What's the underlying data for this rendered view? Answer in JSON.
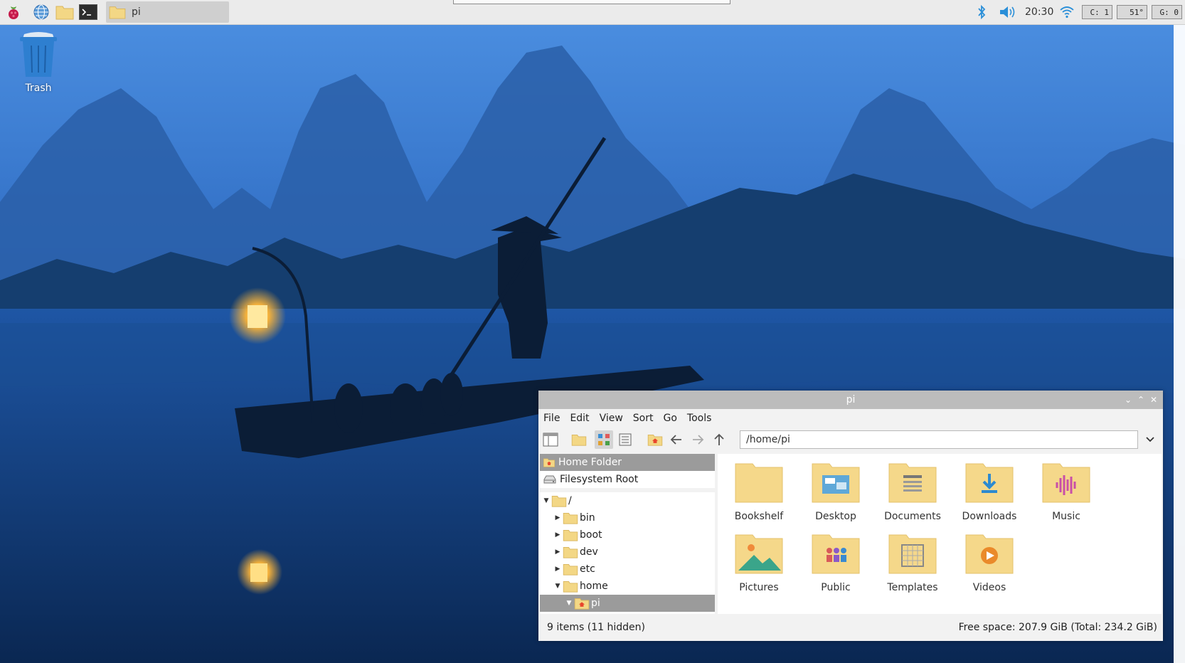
{
  "taskbar": {
    "task_label": "pi",
    "clock": "20:30",
    "monitors": {
      "cpu": "C: 1",
      "temp": "51°",
      "gpu": "G: 0"
    }
  },
  "desktop": {
    "trash_label": "Trash"
  },
  "window": {
    "title": "pi",
    "menu": [
      "File",
      "Edit",
      "View",
      "Sort",
      "Go",
      "Tools"
    ],
    "address": "/home/pi",
    "places": [
      {
        "label": "Home Folder",
        "icon": "home-icon"
      },
      {
        "label": "Filesystem Root",
        "icon": "drive-icon"
      }
    ],
    "tree": [
      {
        "label": "/",
        "arrow": "down",
        "depth": 0
      },
      {
        "label": "bin",
        "arrow": "right",
        "depth": 1
      },
      {
        "label": "boot",
        "arrow": "right",
        "depth": 1
      },
      {
        "label": "dev",
        "arrow": "right",
        "depth": 1
      },
      {
        "label": "etc",
        "arrow": "right",
        "depth": 1
      },
      {
        "label": "home",
        "arrow": "down",
        "depth": 1
      },
      {
        "label": "pi",
        "arrow": "down",
        "depth": 2
      }
    ],
    "items": [
      {
        "label": "Bookshelf",
        "icon": "folder-icon"
      },
      {
        "label": "Desktop",
        "icon": "desktop-folder-icon"
      },
      {
        "label": "Documents",
        "icon": "documents-folder-icon"
      },
      {
        "label": "Downloads",
        "icon": "downloads-folder-icon"
      },
      {
        "label": "Music",
        "icon": "music-folder-icon"
      },
      {
        "label": "Pictures",
        "icon": "pictures-folder-icon"
      },
      {
        "label": "Public",
        "icon": "public-folder-icon"
      },
      {
        "label": "Templates",
        "icon": "templates-folder-icon"
      },
      {
        "label": "Videos",
        "icon": "videos-folder-icon"
      }
    ],
    "status_left": "9 items (11 hidden)",
    "status_right": "Free space: 207.9 GiB (Total: 234.2 GiB)"
  },
  "colors": {
    "folder": "#f5d88a",
    "folder_tab": "#ecc873",
    "accent_blue": "#3aa0e0",
    "selection": "#9b9b9b"
  }
}
